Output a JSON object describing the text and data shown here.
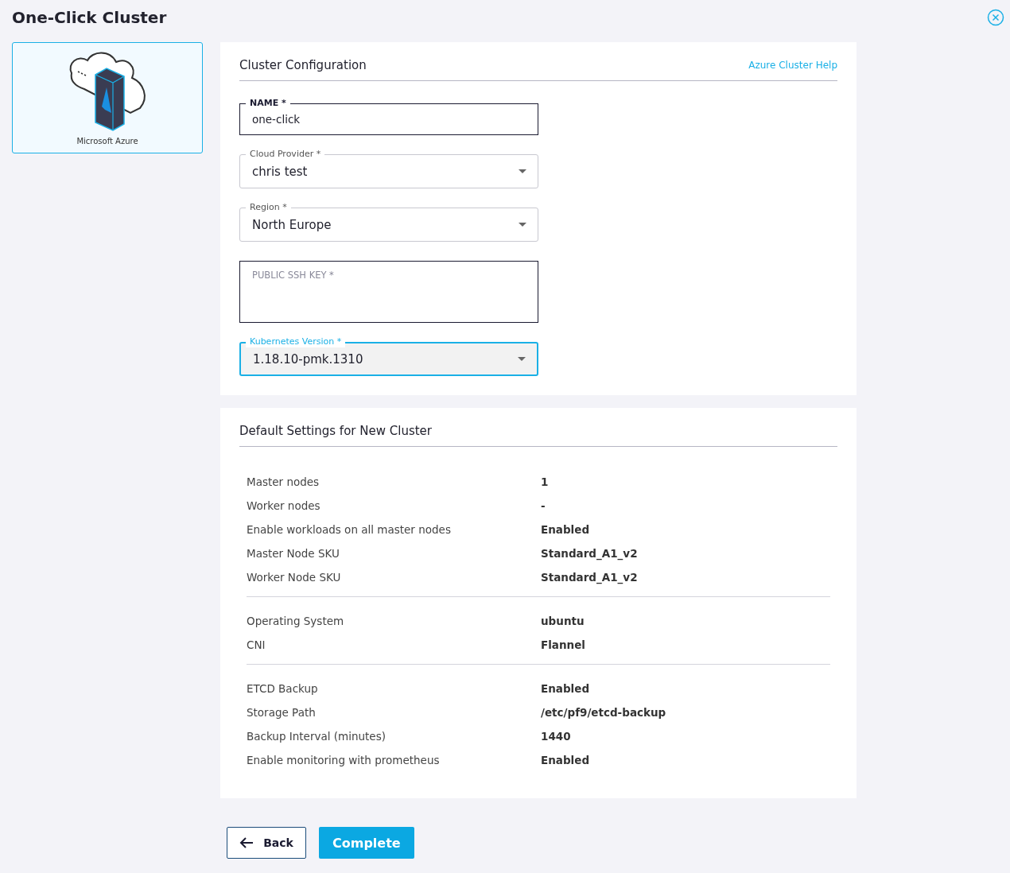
{
  "page": {
    "title": "One-Click Cluster"
  },
  "provider_card": {
    "label": "Microsoft Azure",
    "selected": true
  },
  "config": {
    "title": "Cluster Configuration",
    "help_link": "Azure Cluster Help",
    "fields": [
      {
        "kind": "input",
        "label": "NAME *",
        "value": "one-click",
        "focused": false
      },
      {
        "kind": "select",
        "label": "Cloud Provider *",
        "value": "chris test",
        "focused": false
      },
      {
        "kind": "select",
        "label": "Region *",
        "value": "North Europe",
        "focused": false
      },
      {
        "kind": "textarea",
        "placeholder": "PUBLIC SSH KEY *",
        "focused": false
      },
      {
        "kind": "select",
        "label": "Kubernetes Version *",
        "value": "1.18.10-pmk.1310",
        "focused": true
      }
    ]
  },
  "defaults": {
    "title": "Default Settings for New Cluster",
    "groups": [
      [
        {
          "label": "Master nodes",
          "value": "1"
        },
        {
          "label": "Worker nodes",
          "value": "-"
        },
        {
          "label": "Enable workloads on all master nodes",
          "value": "Enabled"
        },
        {
          "label": "Master Node SKU",
          "value": "Standard_A1_v2"
        },
        {
          "label": "Worker Node SKU",
          "value": "Standard_A1_v2"
        }
      ],
      [
        {
          "label": "Operating System",
          "value": "ubuntu"
        },
        {
          "label": "CNI",
          "value": "Flannel"
        }
      ],
      [
        {
          "label": "ETCD Backup",
          "value": "Enabled"
        },
        {
          "label": "Storage Path",
          "value": "/etc/pf9/etcd-backup"
        },
        {
          "label": "Backup Interval (minutes)",
          "value": "1440"
        },
        {
          "label": "Enable monitoring with prometheus",
          "value": "Enabled"
        }
      ]
    ]
  },
  "buttons": {
    "back": "Back",
    "complete": "Complete"
  }
}
